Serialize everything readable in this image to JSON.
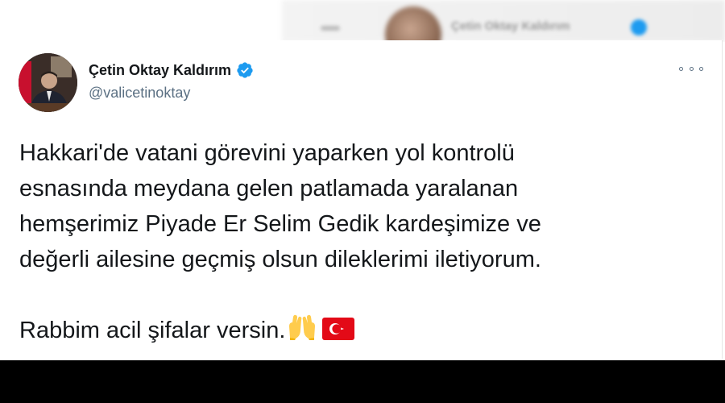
{
  "background_tweet": {
    "name": "Çetin Oktay Kaldırım"
  },
  "tweet": {
    "author_name": "Çetin Oktay Kaldırım",
    "handle": "@valicetinoktay",
    "verified": true,
    "lines": [
      "Hakkari'de vatani görevini yaparken yol kontrolü",
      "esnasında meydana gelen patlamada yaralanan",
      "hemşerimiz Piyade Er Selim Gedik kardeşimize ve",
      "değerli ailesine geçmiş olsun dileklerimi iletiyorum."
    ],
    "closing": "Rabbim acil şifalar versin.",
    "emojis": [
      "raised-hands-emoji",
      "turkey-flag-emoji"
    ],
    "more_icon": "more-horizontal-icon"
  },
  "colors": {
    "verified_blue": "#1d9bf0",
    "text_primary": "#14171a",
    "text_secondary": "#5b7083",
    "flag_red": "#e30a17"
  }
}
